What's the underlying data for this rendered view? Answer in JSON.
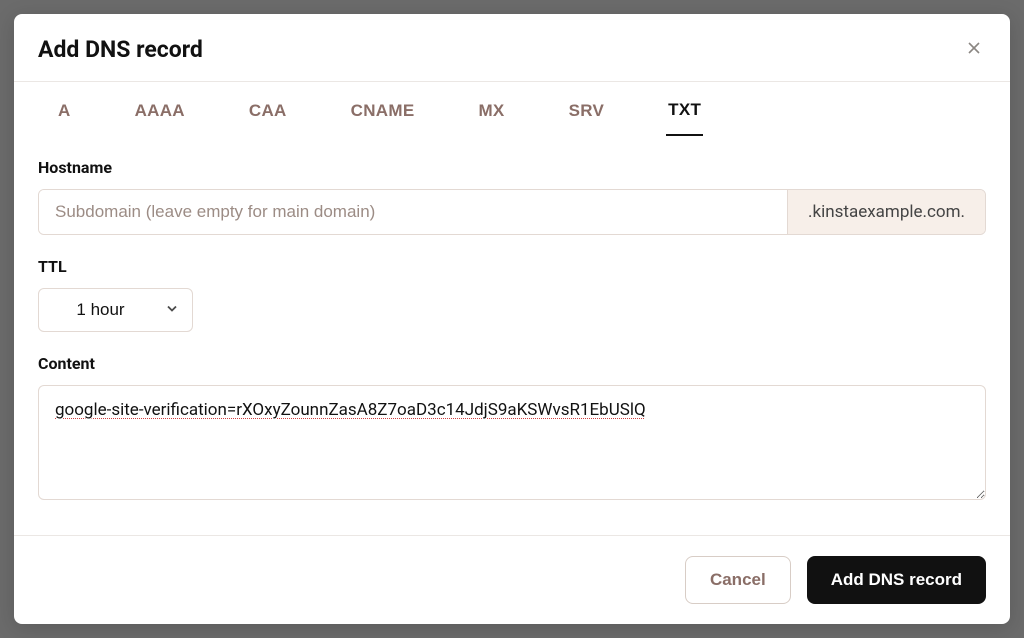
{
  "modal": {
    "title": "Add DNS record",
    "tabs": [
      {
        "label": "A",
        "active": false
      },
      {
        "label": "AAAA",
        "active": false
      },
      {
        "label": "CAA",
        "active": false
      },
      {
        "label": "CNAME",
        "active": false
      },
      {
        "label": "MX",
        "active": false
      },
      {
        "label": "SRV",
        "active": false
      },
      {
        "label": "TXT",
        "active": true
      }
    ],
    "fields": {
      "hostname": {
        "label": "Hostname",
        "placeholder": "Subdomain (leave empty for main domain)",
        "value": "",
        "suffix": ".kinstaexample.com."
      },
      "ttl": {
        "label": "TTL",
        "value": "1 hour"
      },
      "content": {
        "label": "Content",
        "value": "google-site-verification=rXOxyZounnZasA8Z7oaD3c14JdjS9aKSWvsR1EbUSlQ"
      }
    },
    "actions": {
      "cancel": "Cancel",
      "submit": "Add DNS record"
    }
  }
}
